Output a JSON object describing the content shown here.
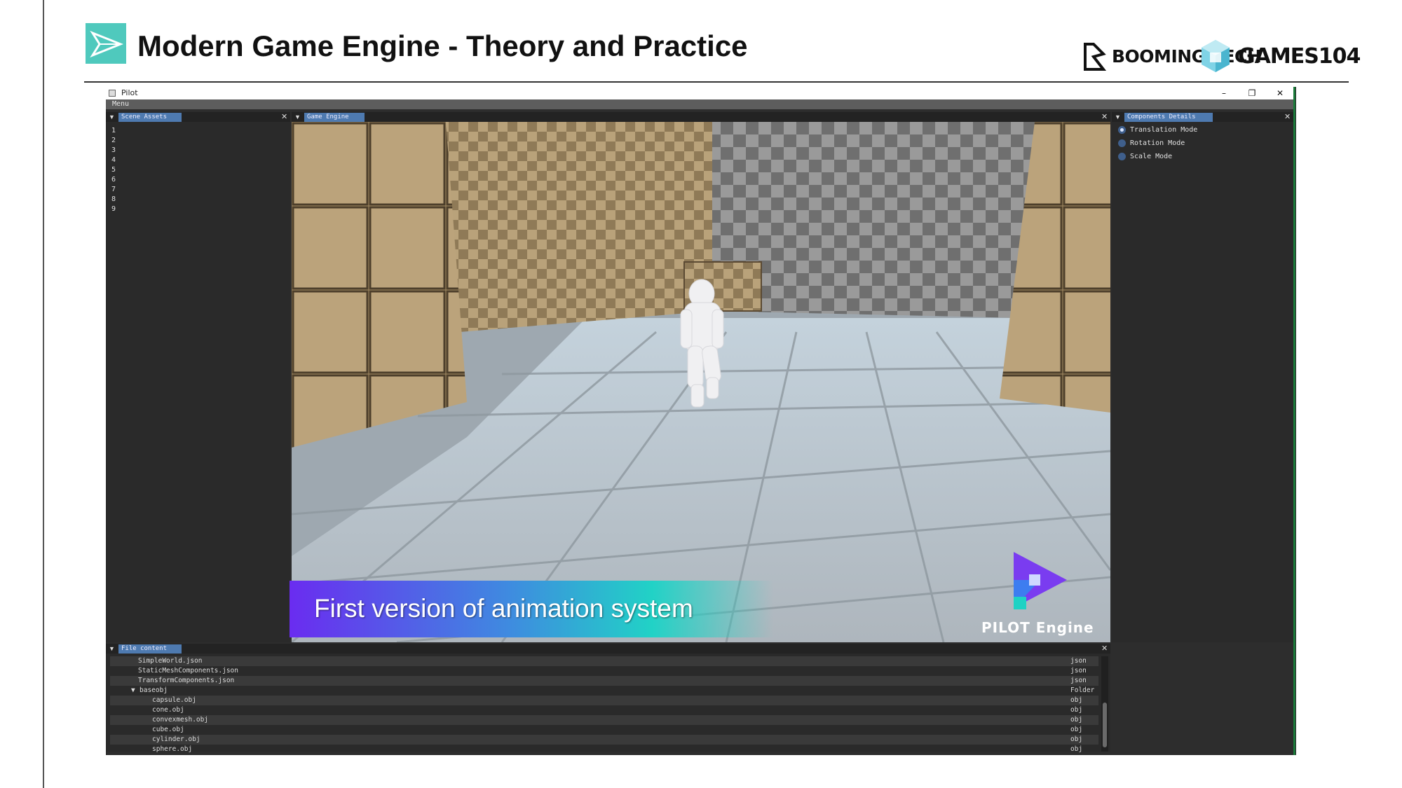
{
  "slide": {
    "title": "Modern Game Engine - Theory and Practice",
    "logos": {
      "booming": "BOOMING TECH",
      "games": "GAMES104"
    },
    "colors": {
      "accent": "#4fc9bd",
      "caption_start": "#6a2cf0",
      "caption_end": "#21d2c6"
    }
  },
  "window": {
    "title": "Pilot",
    "controls": {
      "minimize": "–",
      "restore": "❐",
      "close": "✕"
    },
    "menu": "Menu"
  },
  "scene_assets": {
    "tab": "Scene Assets",
    "items": [
      "1",
      "2",
      "3",
      "4",
      "5",
      "6",
      "7",
      "8",
      "9"
    ]
  },
  "game_engine": {
    "tab": "Game Engine"
  },
  "components": {
    "tab": "Components Details",
    "modes": [
      {
        "label": "Translation Mode",
        "selected": true
      },
      {
        "label": "Rotation Mode",
        "selected": false
      },
      {
        "label": "Scale Mode",
        "selected": false
      }
    ]
  },
  "file_content": {
    "tab": "File content",
    "rows": [
      {
        "name": "SimpleWorld.json",
        "type": "json",
        "indent": 1
      },
      {
        "name": "StaticMeshComponents.json",
        "type": "json",
        "indent": 1
      },
      {
        "name": "TransformComponents.json",
        "type": "json",
        "indent": 1
      },
      {
        "name": "baseobj",
        "type": "Folder",
        "indent": 0,
        "folder": true
      },
      {
        "name": "capsule.obj",
        "type": "obj",
        "indent": 2
      },
      {
        "name": "cone.obj",
        "type": "obj",
        "indent": 2
      },
      {
        "name": "convexmesh.obj",
        "type": "obj",
        "indent": 2
      },
      {
        "name": "cube.obj",
        "type": "obj",
        "indent": 2
      },
      {
        "name": "cylinder.obj",
        "type": "obj",
        "indent": 2
      },
      {
        "name": "sphere.obj",
        "type": "obj",
        "indent": 2
      }
    ]
  },
  "overlay": {
    "caption": "First version of animation system",
    "engine_logo": "PILOT Engine"
  }
}
